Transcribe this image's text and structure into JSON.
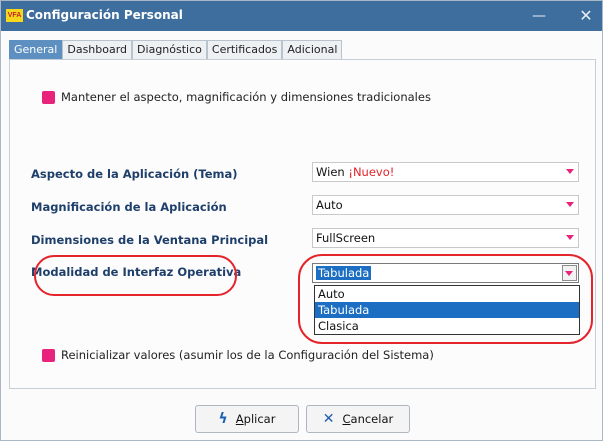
{
  "window": {
    "app_icon_text": "VFA",
    "title": "Configuración Personal",
    "minimize_glyph": "—",
    "close_glyph": "✕"
  },
  "tabs": [
    {
      "label": "General",
      "active": true
    },
    {
      "label": "Dashboard",
      "active": false
    },
    {
      "label": "Diagnóstico",
      "active": false
    },
    {
      "label": "Certificados",
      "active": false
    },
    {
      "label": "Adicional",
      "active": false
    }
  ],
  "general": {
    "keep_traditional": {
      "label": "Mantener el aspecto, magnificación y dimensiones tradicionales"
    },
    "fields": [
      {
        "label": "Aspecto de la Aplicación (Tema)",
        "value": "Wien",
        "badge": "¡Nuevo!"
      },
      {
        "label": "Magnificación de la Aplicación",
        "value": "Auto"
      },
      {
        "label": "Dimensiones de la Ventana Principal",
        "value": "FullScreen"
      },
      {
        "label": "Modalidad de Interfaz Operativa",
        "value": "Tabulada"
      }
    ],
    "dropdown_options": [
      "Auto",
      "Tabulada",
      "Clasica"
    ],
    "dropdown_selected_index": 1,
    "reset": {
      "label": "Reinicializar valores (asumir los de la Configuración del Sistema)"
    }
  },
  "buttons": {
    "apply_first": "A",
    "apply_rest": "plicar",
    "cancel_first": "C",
    "cancel_rest": "ancelar"
  },
  "colors": {
    "titlebar": "#3e6e9d",
    "accent_pink": "#e8237c",
    "annotation_red": "#e4242b",
    "selection_blue": "#1b6ec2"
  },
  "icons": {
    "apply": "lightning-icon",
    "cancel": "x-icon"
  }
}
